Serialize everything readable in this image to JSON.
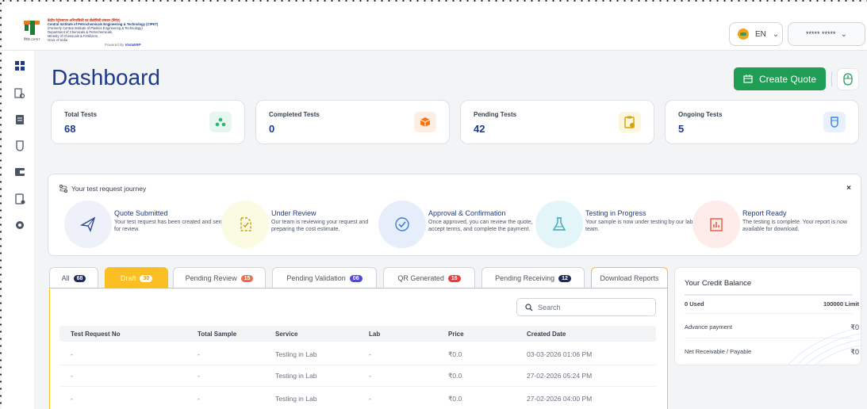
{
  "header": {
    "logo": {
      "org_hindi": "केंद्रीय पेट्रोरसायन अभियांत्रिकी एवं प्रौद्योगिकी संस्थान (सिपेट)",
      "org_english": "Central Institute of Petrochemicals Engineering & Technology (CIPET)",
      "line3": "(Formerly Central Institute of Plastics Engineering & Technology)",
      "line4": "Department of Chemicals & Petrochemicals,",
      "line5": "Ministry of Chemicals & Fertilizers,",
      "line6": "Govt. of India",
      "sub_label": "सिपेट CIPET",
      "powered_by": "Powered By",
      "powered_brand": "VistaERP"
    },
    "language": "EN",
    "user_masked": "***** *****"
  },
  "page": {
    "title": "Dashboard",
    "create_quote_label": "Create Quote"
  },
  "stats": [
    {
      "label": "Total Tests",
      "value": "68",
      "icon": "dots-icon",
      "color": "#2bb673"
    },
    {
      "label": "Completed Tests",
      "value": "0",
      "icon": "box-icon",
      "color": "#f97316"
    },
    {
      "label": "Pending Tests",
      "value": "42",
      "icon": "clipboard-clock-icon",
      "color": "#d4a106"
    },
    {
      "label": "Ongoing Tests",
      "value": "5",
      "icon": "test-tube-icon",
      "color": "#3b82f6"
    }
  ],
  "journey": {
    "title": "Your test request journey",
    "close": "×",
    "steps": [
      {
        "title": "Quote Submitted",
        "desc": "Your test request has been created and sent for review."
      },
      {
        "title": "Under Review",
        "desc": "Our team is reviewing your request and preparing the cost estimate."
      },
      {
        "title": "Approval & Confirmation",
        "desc": "Once approved, you can review the quote, accept terms, and complete the payment."
      },
      {
        "title": "Testing in Progress",
        "desc": "Your sample is now under testing by our lab team."
      },
      {
        "title": "Report Ready",
        "desc": "The testing is complete. Your report is now available for download."
      }
    ]
  },
  "tabs": [
    {
      "label": "All",
      "count": "68"
    },
    {
      "label": "Draft",
      "count": "30"
    },
    {
      "label": "Pending Review",
      "count": "15"
    },
    {
      "label": "Pending Validation",
      "count": "06"
    },
    {
      "label": "QR Generated",
      "count": "16"
    },
    {
      "label": "Pending Receiving",
      "count": "12"
    },
    {
      "label": "Download Reports",
      "count": ""
    }
  ],
  "search": {
    "placeholder": "Search"
  },
  "table": {
    "columns": [
      "Test Request No",
      "Total Sample",
      "Service",
      "Lab",
      "Price",
      "Created Date"
    ],
    "rows": [
      [
        "-",
        "-",
        "Testing in Lab",
        "-",
        "₹0.0",
        "03-03-2026 01:06 PM"
      ],
      [
        "-",
        "-",
        "Testing in Lab",
        "-",
        "₹0.0",
        "27-02-2026 05:24 PM"
      ],
      [
        "-",
        "-",
        "Testing in Lab",
        "-",
        "₹0.0",
        "27-02-2026 04:00 PM"
      ]
    ]
  },
  "credit": {
    "title": "Your Credit Balance",
    "used": "0 Used",
    "limit": "100000 Limit",
    "advance_label": "Advance payment",
    "advance_value": "₹0",
    "net_label": "Net Receivable / Payable",
    "net_value": "₹0"
  },
  "colors": {
    "primary": "#1e3a8a",
    "green": "#1f9d55",
    "draft": "#fbbf24",
    "badge_dark": "#1e2a5a",
    "badge_orange": "#f26b4f",
    "badge_purple": "#4f46e5",
    "badge_red": "#e53e3e"
  }
}
